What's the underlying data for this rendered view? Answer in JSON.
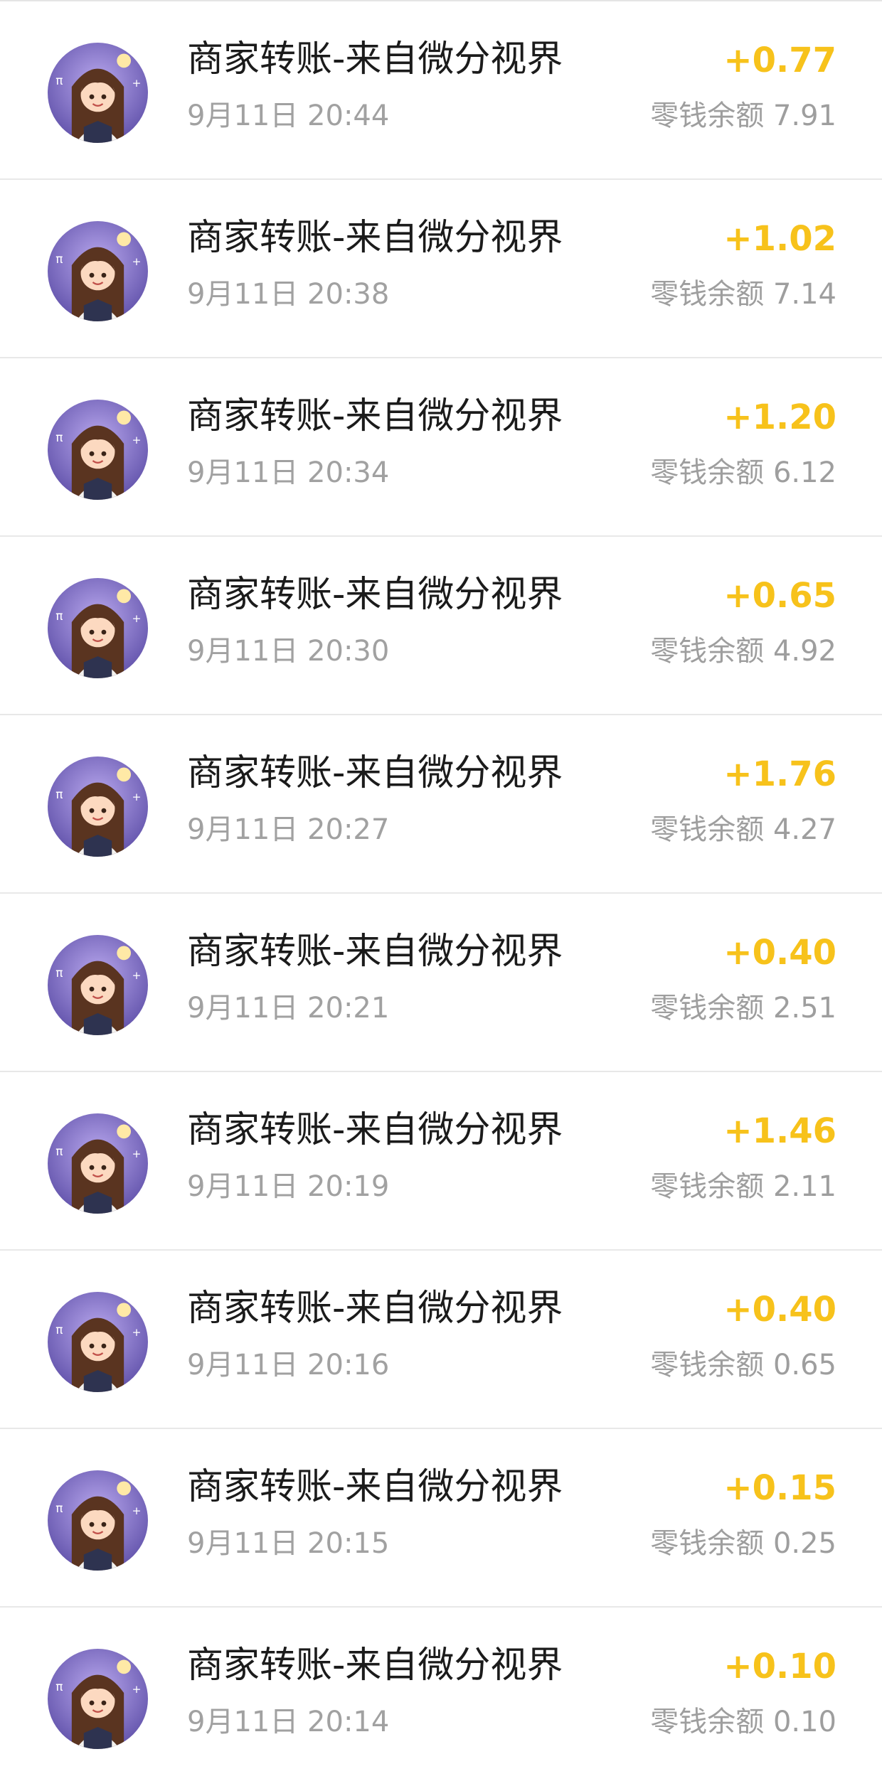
{
  "colors": {
    "amount": "#F7C21B",
    "avatar_bg": "#7C6BC4"
  },
  "avatar_icon": "cartoon-girl-avatar-icon",
  "transactions": [
    {
      "title": "商家转账-来自微分视界",
      "time": "9月11日 20:44",
      "amount": "+0.77",
      "balance_label": "零钱余额",
      "balance": "7.91"
    },
    {
      "title": "商家转账-来自微分视界",
      "time": "9月11日 20:38",
      "amount": "+1.02",
      "balance_label": "零钱余额",
      "balance": "7.14"
    },
    {
      "title": "商家转账-来自微分视界",
      "time": "9月11日 20:34",
      "amount": "+1.20",
      "balance_label": "零钱余额",
      "balance": "6.12"
    },
    {
      "title": "商家转账-来自微分视界",
      "time": "9月11日 20:30",
      "amount": "+0.65",
      "balance_label": "零钱余额",
      "balance": "4.92"
    },
    {
      "title": "商家转账-来自微分视界",
      "time": "9月11日 20:27",
      "amount": "+1.76",
      "balance_label": "零钱余额",
      "balance": "4.27"
    },
    {
      "title": "商家转账-来自微分视界",
      "time": "9月11日 20:21",
      "amount": "+0.40",
      "balance_label": "零钱余额",
      "balance": "2.51"
    },
    {
      "title": "商家转账-来自微分视界",
      "time": "9月11日 20:19",
      "amount": "+1.46",
      "balance_label": "零钱余额",
      "balance": "2.11"
    },
    {
      "title": "商家转账-来自微分视界",
      "time": "9月11日 20:16",
      "amount": "+0.40",
      "balance_label": "零钱余额",
      "balance": "0.65"
    },
    {
      "title": "商家转账-来自微分视界",
      "time": "9月11日 20:15",
      "amount": "+0.15",
      "balance_label": "零钱余额",
      "balance": "0.25"
    },
    {
      "title": "商家转账-来自微分视界",
      "time": "9月11日 20:14",
      "amount": "+0.10",
      "balance_label": "零钱余额",
      "balance": "0.10"
    }
  ]
}
